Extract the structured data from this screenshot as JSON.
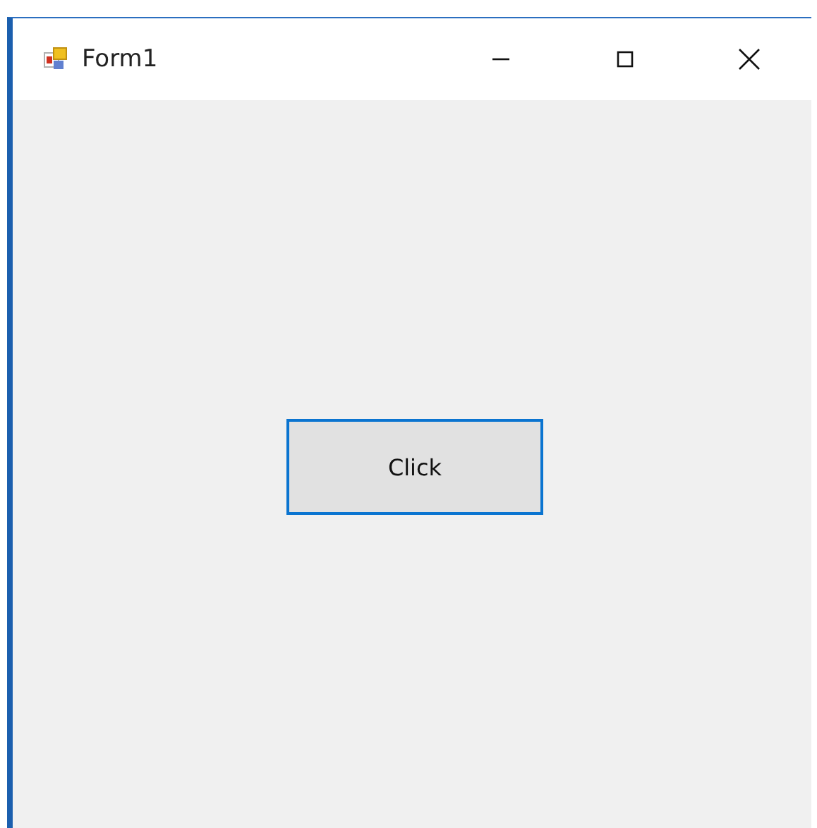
{
  "window": {
    "title": "Form1"
  },
  "button": {
    "label": "Click"
  }
}
